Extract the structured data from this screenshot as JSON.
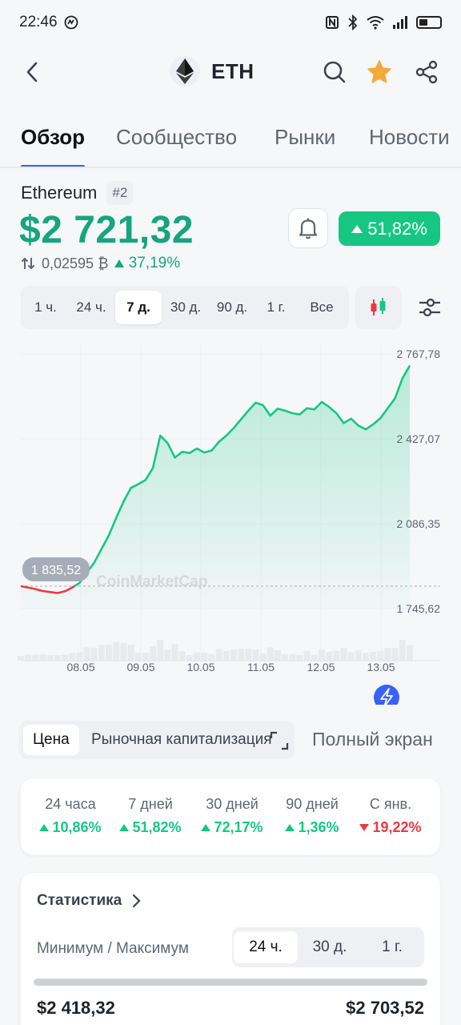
{
  "status": {
    "time": "22:46"
  },
  "header": {
    "symbol": "ETH"
  },
  "tabs": [
    {
      "label": "Обзор",
      "active": true
    },
    {
      "label": "Сообщество"
    },
    {
      "label": "Рынки"
    },
    {
      "label": "Новости"
    }
  ],
  "coin": {
    "name": "Ethereum",
    "rank": "#2",
    "price": "$2 721,32",
    "change_7d": "51,82%",
    "btc_price": "0,02595 ₿",
    "btc_change": "37,19%"
  },
  "ranges": [
    "1 ч.",
    "24 ч.",
    "7 д.",
    "30 д.",
    "90 д.",
    "1 г.",
    "Все"
  ],
  "selected_range": "7 д.",
  "chart_data": {
    "type": "line",
    "x_labels": [
      "08.05",
      "09.05",
      "10.05",
      "11.05",
      "12.05",
      "13.05"
    ],
    "y_ticks": [
      "2 767,78",
      "2 427,07",
      "2 086,35",
      "1 745,62"
    ],
    "ylim": [
      1745.62,
      2767.78
    ],
    "start_label": "1 835,52",
    "start_value": 1835.52,
    "watermark": "CoinMarketCap",
    "values": [
      1835.52,
      1830,
      1824,
      1816,
      1812,
      1808,
      1815,
      1830,
      1848,
      1890,
      1930,
      1985,
      2040,
      2110,
      2175,
      2230,
      2245,
      2262,
      2310,
      2440,
      2410,
      2352,
      2375,
      2370,
      2388,
      2372,
      2380,
      2415,
      2440,
      2470,
      2505,
      2540,
      2572,
      2562,
      2520,
      2548,
      2540,
      2530,
      2525,
      2550,
      2545,
      2575,
      2555,
      2530,
      2490,
      2508,
      2480,
      2465,
      2485,
      2510,
      2550,
      2590,
      2670,
      2721
    ],
    "colors": {
      "up": "#16c784",
      "down": "#ea3943"
    }
  },
  "chart_modes": [
    "Цена",
    "Рыночная капитализация"
  ],
  "fullscreen_label": "Полный экран",
  "performance": [
    {
      "label": "24 часа",
      "value": "10,86%",
      "dir": "up"
    },
    {
      "label": "7 дней",
      "value": "51,82%",
      "dir": "up"
    },
    {
      "label": "30 дней",
      "value": "72,17%",
      "dir": "up"
    },
    {
      "label": "90 дней",
      "value": "1,36%",
      "dir": "up"
    },
    {
      "label": "С янв.",
      "value": "19,22%",
      "dir": "down"
    }
  ],
  "stats": {
    "title": "Статистика",
    "minmax_label": "Минимум / Максимум",
    "periods": [
      "24 ч.",
      "30 д.",
      "1 г."
    ],
    "min": "$2 418,32",
    "max": "$2 703,52"
  },
  "icons": {
    "back": "chevron-left-icon",
    "search": "search-icon",
    "favorite": "star-icon",
    "share": "share-icon",
    "alert": "bell-icon",
    "candles": "candlestick-icon",
    "settings": "sliders-icon"
  }
}
